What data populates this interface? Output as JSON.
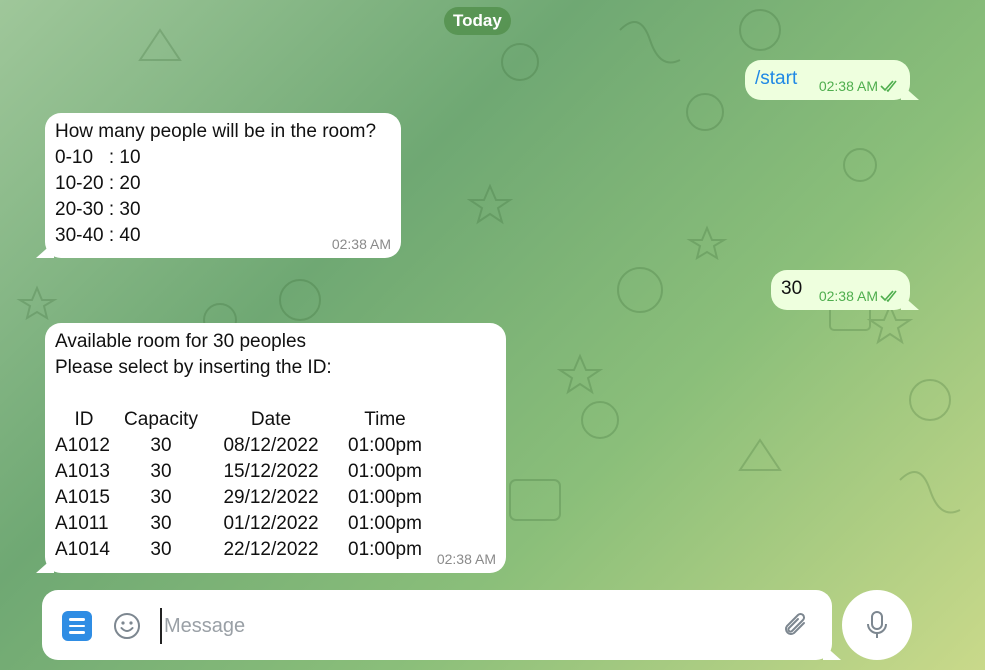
{
  "date_label": "Today",
  "messages": [
    {
      "direction": "out",
      "text": "/start",
      "time": "02:38 AM"
    },
    {
      "direction": "in",
      "lines": [
        "How many people will be in the room?",
        "0-10   : 10",
        "10-20 : 20",
        "20-30 : 30",
        "30-40 : 40"
      ],
      "time": "02:38 AM"
    },
    {
      "direction": "out",
      "text": "30",
      "time": "02:38 AM"
    },
    {
      "direction": "in",
      "lines": [
        "Available room for 30 peoples",
        "Please select by inserting the ID:"
      ],
      "table": {
        "headers": [
          "ID",
          "Capacity",
          "Date",
          "Time"
        ],
        "rows": [
          [
            "A1012",
            "30",
            "08/12/2022",
            "01:00pm"
          ],
          [
            "A1013",
            "30",
            "15/12/2022",
            "01:00pm"
          ],
          [
            "A1015",
            "30",
            "29/12/2022",
            "01:00pm"
          ],
          [
            "A1011",
            "30",
            "01/12/2022",
            "01:00pm"
          ],
          [
            "A1014",
            "30",
            "22/12/2022",
            "01:00pm"
          ]
        ]
      },
      "time": "02:38 AM"
    }
  ],
  "composer": {
    "placeholder": "Message",
    "value": ""
  },
  "icons": {
    "menu": "menu-icon",
    "emoji": "emoji-icon",
    "attach": "paperclip-icon",
    "mic": "microphone-icon",
    "read": "double-check-icon"
  },
  "colors": {
    "outgoing_bubble": "#eeffde",
    "incoming_bubble": "#ffffff",
    "command_link": "#1e88e5",
    "read_check": "#4fae4e",
    "menu_button": "#2f8de4"
  }
}
